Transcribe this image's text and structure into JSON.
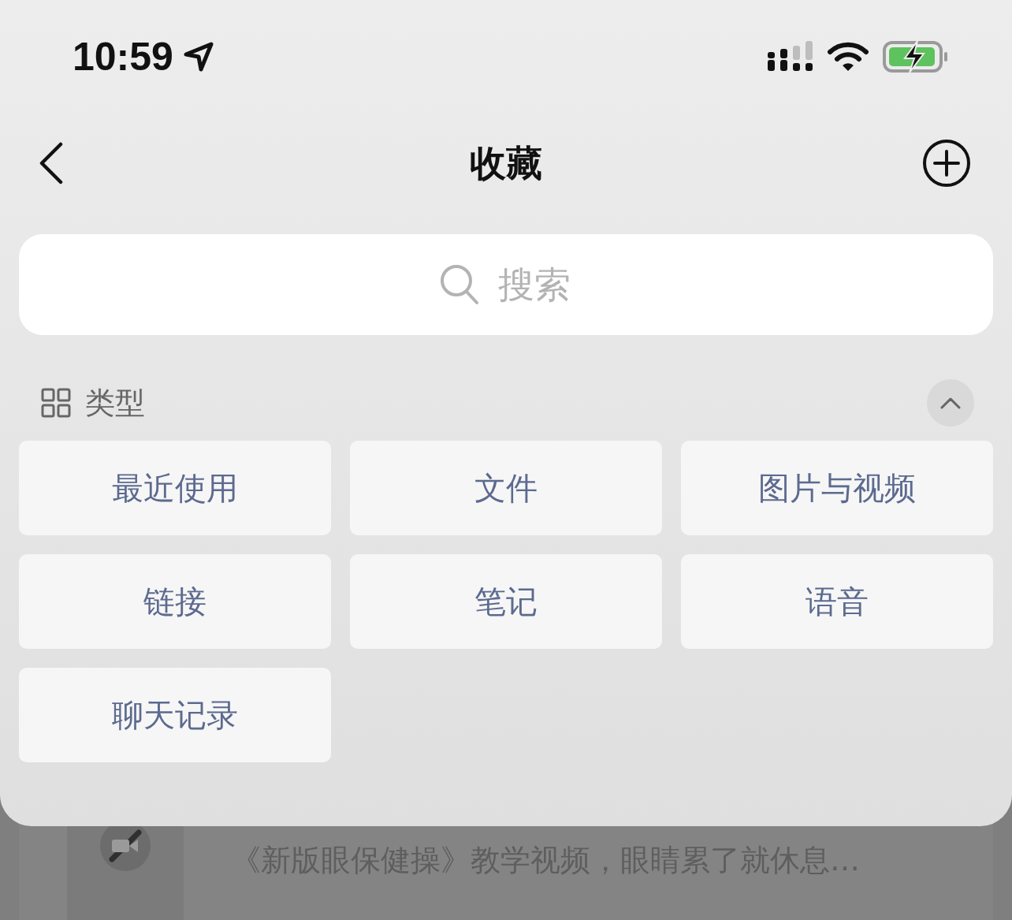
{
  "status_bar": {
    "time": "10:59"
  },
  "nav": {
    "title": "收藏"
  },
  "search": {
    "placeholder": "搜索"
  },
  "section": {
    "title": "类型",
    "expanded": true
  },
  "categories": [
    {
      "label": "最近使用"
    },
    {
      "label": "文件"
    },
    {
      "label": "图片与视频"
    },
    {
      "label": "链接"
    },
    {
      "label": "笔记"
    },
    {
      "label": "语音"
    },
    {
      "label": "聊天记录"
    }
  ],
  "background_item": {
    "subtitle": "《新版眼保健操》教学视频，眼睛累了就休息…"
  }
}
